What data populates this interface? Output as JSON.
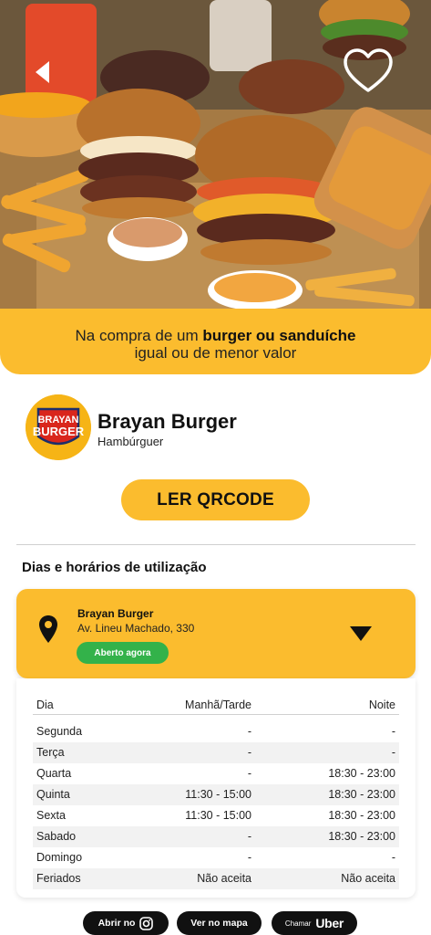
{
  "promo": {
    "line1_prefix": "Na compra de  um ",
    "line1_bold": "burger ou sanduíche",
    "line2": "igual ou de menor valor"
  },
  "store": {
    "name": "Brayan Burger",
    "category": "Hambúrguer",
    "logo_text_top": "BRAYAN",
    "logo_text_bottom": "BURGER"
  },
  "qr_button_label": "LER QRCODE",
  "section_title": "Dias e horários de utilização",
  "location": {
    "name": "Brayan Burger",
    "address": "Av. Lineu Machado, 330",
    "status": "Aberto agora"
  },
  "schedule": {
    "headers": [
      "Dia",
      "Manhã/Tarde",
      "Noite"
    ],
    "rows": [
      {
        "day": "Segunda",
        "mid": "-",
        "night": "-"
      },
      {
        "day": "Terça",
        "mid": "-",
        "night": "-"
      },
      {
        "day": "Quarta",
        "mid": "-",
        "night": "18:30 - 23:00"
      },
      {
        "day": "Quinta",
        "mid": "11:30 - 15:00",
        "night": "18:30 - 23:00"
      },
      {
        "day": "Sexta",
        "mid": "11:30 - 15:00",
        "night": "18:30 - 23:00"
      },
      {
        "day": "Sabado",
        "mid": "-",
        "night": "18:30 - 23:00"
      },
      {
        "day": "Domingo",
        "mid": "-",
        "night": "-"
      },
      {
        "day": "Feriados",
        "mid": "Não aceita",
        "night": "Não aceita"
      }
    ]
  },
  "buttons": {
    "instagram": "Abrir no",
    "map": "Ver no mapa",
    "uber_prefix": "Chamar",
    "uber_brand": "Uber"
  },
  "colors": {
    "accent": "#fbbc2e",
    "open_green": "#33b24a",
    "button_dark": "#111111"
  },
  "icons": [
    "back-arrow-icon",
    "heart-icon",
    "location-pin-icon",
    "chevron-down-icon",
    "instagram-icon"
  ]
}
